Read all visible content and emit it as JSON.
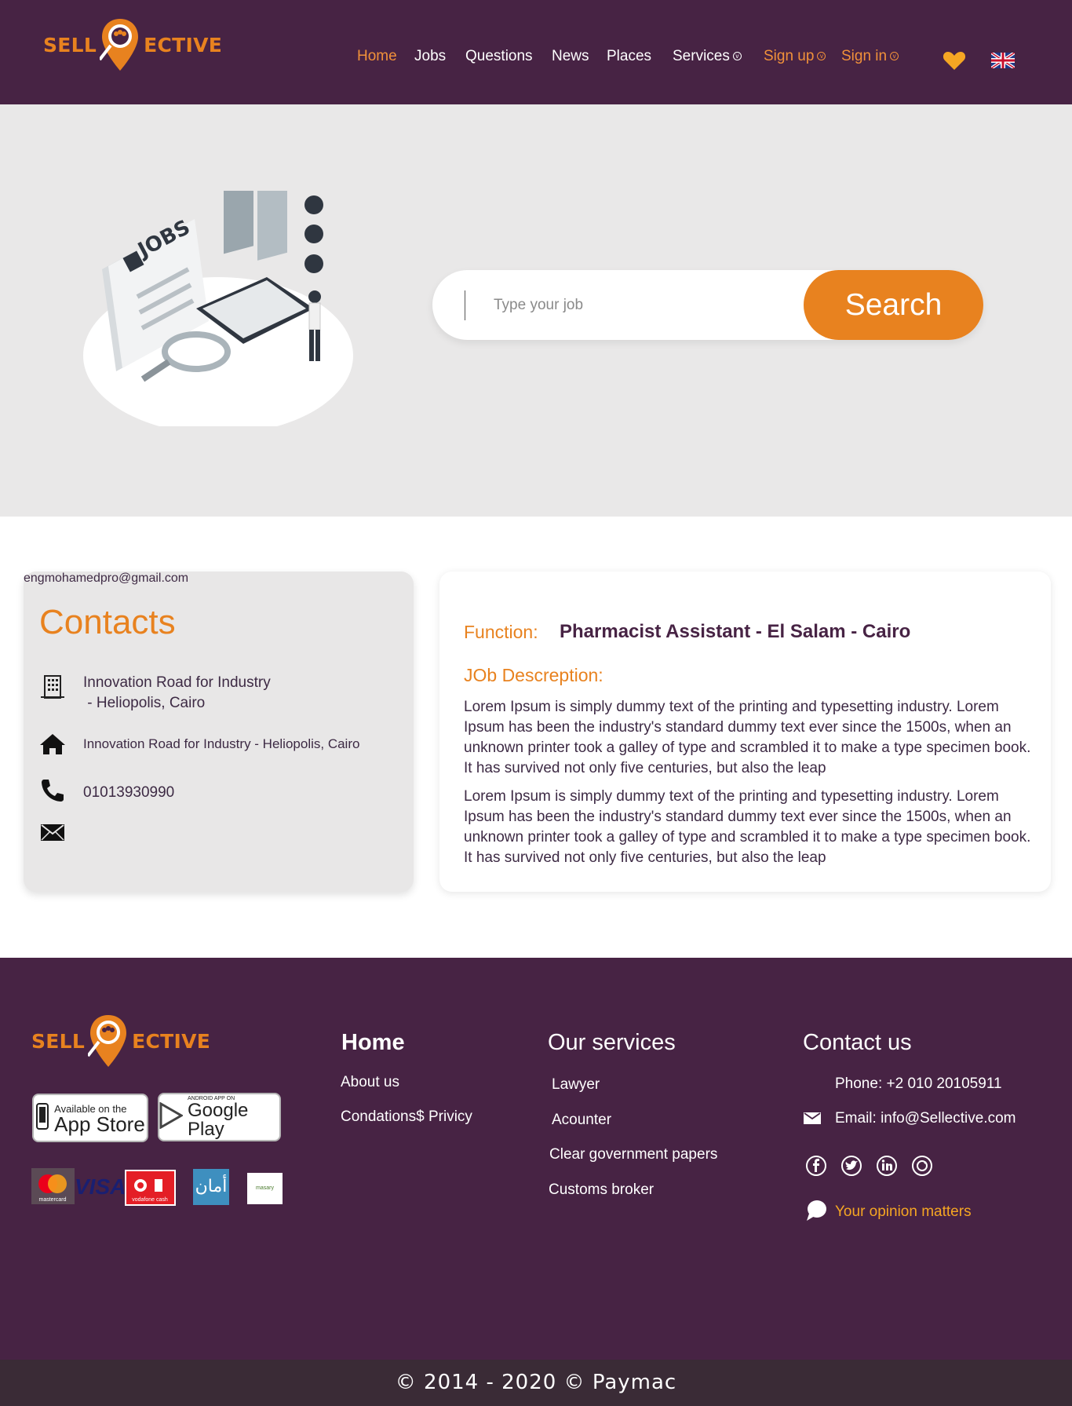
{
  "brand": {
    "left": "SELL",
    "right": "ECTIVE"
  },
  "nav": {
    "items": [
      {
        "label": "Home"
      },
      {
        "label": "Jobs"
      },
      {
        "label": "Questions"
      },
      {
        "label": "News"
      },
      {
        "label": "Places"
      },
      {
        "label": "Services"
      },
      {
        "label": "Sign up"
      },
      {
        "label": "Sign in"
      }
    ],
    "caret": "⌄"
  },
  "hero": {
    "illustration_text": "JOBS",
    "search": {
      "placeholder": "Type your job",
      "value": "",
      "button": "Search"
    }
  },
  "contacts": {
    "title": "Contacts",
    "address_line1": "Innovation Road for Industry",
    "address_line2": " - Heliopolis, Cairo",
    "home_address": "Innovation Road for Industry - Heliopolis, Cairo",
    "phone": "01013930990",
    "email": "engmohamedpro@gmail.com"
  },
  "job": {
    "function_label": "Function:",
    "function_value": "Pharmacist Assistant - El Salam - Cairo",
    "description_label": "JOb Descreption:",
    "paragraphs": [
      "Lorem Ipsum is simply dummy text of the printing and typesetting industry. Lorem Ipsum has been the industry's standard dummy text ever since the 1500s, when an unknown printer took a galley of type and scrambled it to make a type specimen book. It has survived not only five centuries, but also the leap",
      "Lorem Ipsum is simply dummy text of the printing and typesetting industry. Lorem Ipsum has been the industry's standard dummy text ever since the 1500s, when an unknown printer took a galley of type and scrambled it to make a type specimen book. It has survived not only five centuries, but also the leap"
    ]
  },
  "footer": {
    "app_store": {
      "small": "Available on the",
      "big": "App Store"
    },
    "google_play": {
      "small": "ANDROID APP ON",
      "big": "Google Play"
    },
    "payments": {
      "mastercard": "mastercard",
      "visa": "VISA",
      "vodafone": "vodafone cash",
      "aman": "أمان",
      "masary": "masary"
    },
    "home_col": {
      "title": "Home",
      "links": [
        "About us",
        "Condations$ Privicy"
      ]
    },
    "services_col": {
      "title": "Our services",
      "links": [
        "Lawyer",
        "Acounter",
        "Clear government papers",
        "Customs broker"
      ]
    },
    "contact_col": {
      "title": "Contact us",
      "phone": "Phone: +2 010 20105911",
      "email": "Email: info@Sellective.com",
      "opinion": "Your opinion matters"
    },
    "copyright": "© 2014 - 2020 © Paymac"
  },
  "colors": {
    "purple": "#472344",
    "orange": "#e8821f",
    "hero_bg": "#e9e8e8",
    "copyright_bg": "#3a2b36",
    "opinion": "#f5a623"
  }
}
